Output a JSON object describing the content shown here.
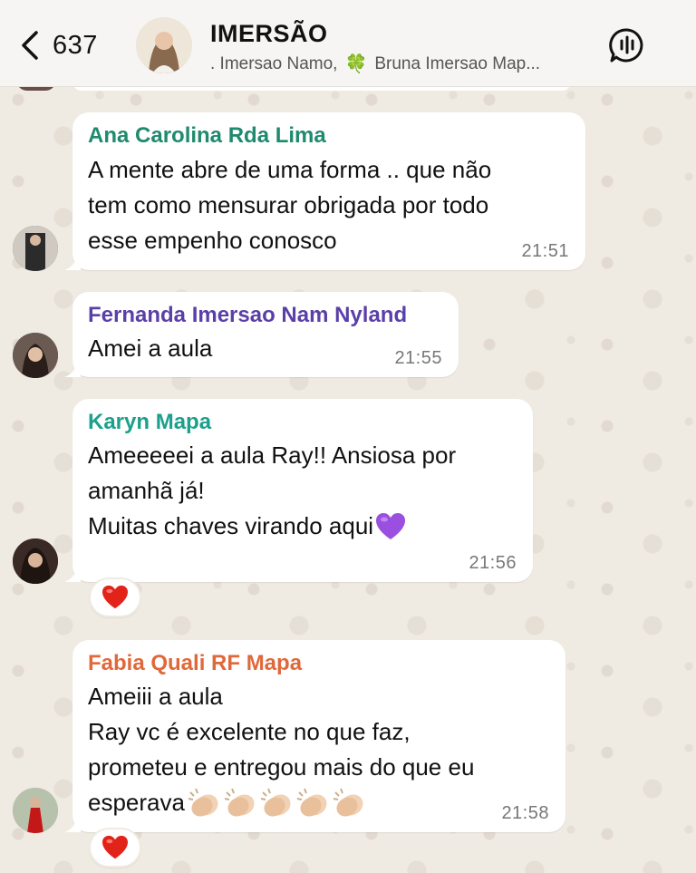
{
  "header": {
    "back_count": "637",
    "title": "IMERSÃO",
    "subtitle_part1": ". Imersao Namo,",
    "subtitle_part2": "Bruna Imersao Map..."
  },
  "messages": [
    {
      "sender": "Ana Carolina Rda Lima",
      "sender_color": "#1f8a6e",
      "lines": [
        "A mente abre de uma forma .. que não",
        "tem como mensurar obrigada por todo",
        "esse empenho conosco"
      ],
      "time": "21:51"
    },
    {
      "sender": "Fernanda Imersao Nam Nyland",
      "sender_color": "#5b3fa8",
      "lines": [
        "Amei a aula"
      ],
      "time": "21:55"
    },
    {
      "sender": "Karyn Mapa",
      "sender_color": "#1aa08c",
      "lines": [
        "Ameeeeei a aula Ray!! Ansiosa por",
        "amanhã já!",
        "Muitas chaves virando aqui"
      ],
      "time": "21:56",
      "reaction": "heart"
    },
    {
      "sender": "Fabia Quali RF Mapa",
      "sender_color": "#e0683a",
      "lines": [
        "Ameiii a aula",
        "Ray vc é excelente no que faz,",
        "prometeu e entregou mais do que eu",
        "esperava"
      ],
      "time": "21:58",
      "reaction": "heart"
    }
  ],
  "icons": {
    "back": "chevron-left-icon",
    "call": "group-call-icon",
    "clover": "four-leaf-clover-icon",
    "purple_heart": "purple-heart-emoji",
    "clapping": "clapping-hands-emoji",
    "red_heart": "red-heart-emoji"
  },
  "colors": {
    "chat_background": "#efeae2",
    "bubble": "#ffffff",
    "header": "#f6f5f3"
  }
}
